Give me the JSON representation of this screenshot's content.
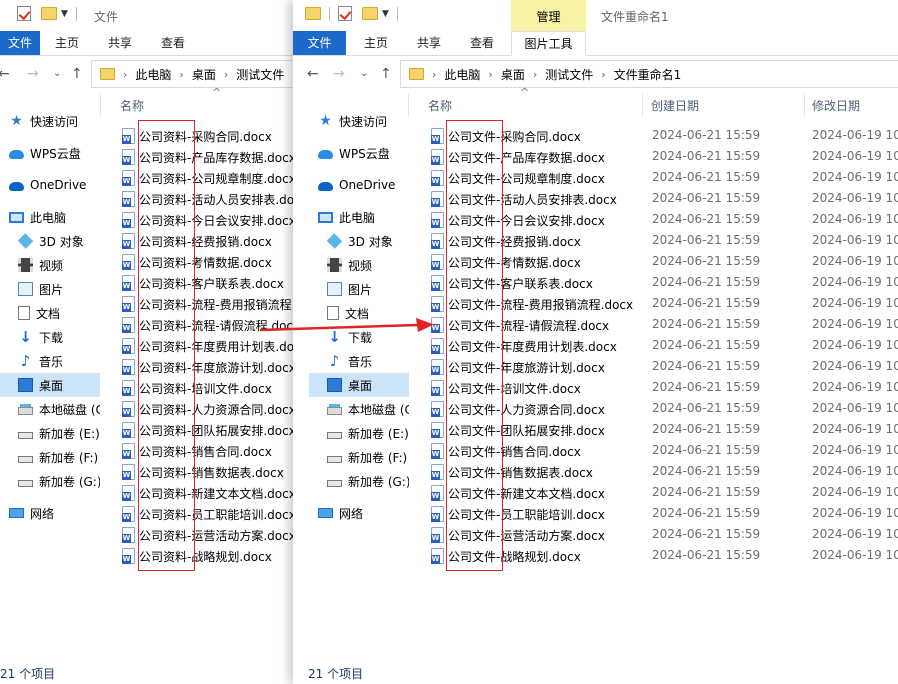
{
  "left_window": {
    "title": "文件",
    "ribbon": {
      "file": "文件",
      "home": "主页",
      "share": "共享",
      "view": "查看"
    },
    "address": [
      "此电脑",
      "桌面",
      "测试文件"
    ],
    "column_name": "名称",
    "status": "21 个项目"
  },
  "right_window": {
    "title": "文件重命名1",
    "ribbon": {
      "file": "文件",
      "home": "主页",
      "share": "共享",
      "view": "查看",
      "manage": "管理",
      "picture_tools": "图片工具"
    },
    "address": [
      "此电脑",
      "桌面",
      "测试文件",
      "文件重命名1"
    ],
    "columns": {
      "name": "名称",
      "created": "创建日期",
      "modified": "修改日期"
    },
    "status": "21 个项目"
  },
  "nav_items": [
    {
      "label": "快速访问",
      "icon": "star-icon"
    },
    {
      "label": "WPS云盘",
      "icon": "cloud-icon"
    },
    {
      "label": "OneDrive",
      "icon": "onedrive-icon"
    },
    {
      "label": "此电脑",
      "icon": "computer-icon"
    },
    {
      "label": "3D 对象",
      "icon": "cube-icon"
    },
    {
      "label": "视频",
      "icon": "video-icon"
    },
    {
      "label": "图片",
      "icon": "picture-icon"
    },
    {
      "label": "文档",
      "icon": "document-icon"
    },
    {
      "label": "下载",
      "icon": "download-icon"
    },
    {
      "label": "音乐",
      "icon": "music-icon"
    },
    {
      "label": "桌面",
      "icon": "desktop-icon"
    },
    {
      "label": "本地磁盘 (C:)",
      "icon": "local-disk-icon"
    },
    {
      "label": "新加卷 (E:)",
      "icon": "drive-icon"
    },
    {
      "label": "新加卷 (F:)",
      "icon": "drive-icon"
    },
    {
      "label": "新加卷 (G:)",
      "icon": "drive-icon"
    },
    {
      "label": "网络",
      "icon": "network-icon"
    }
  ],
  "left_files": [
    "公司资料-采购合同.docx",
    "公司资料-产品库存数据.docx",
    "公司资料-公司规章制度.docx",
    "公司资料-活动人员安排表.docx",
    "公司资料-今日会议安排.docx",
    "公司资料-经费报销.docx",
    "公司资料-考情数据.docx",
    "公司资料-客户联系表.docx",
    "公司资料-流程-费用报销流程.docx",
    "公司资料-流程-请假流程.docx",
    "公司资料-年度费用计划表.docx",
    "公司资料-年度旅游计划.docx",
    "公司资料-培训文件.docx",
    "公司资料-人力资源合同.docx",
    "公司资料-团队拓展安排.docx",
    "公司资料-销售合同.docx",
    "公司资料-销售数据表.docx",
    "公司资料-新建文本文档.docx",
    "公司资料-员工职能培训.docx",
    "公司资料-运营活动方案.docx",
    "公司资料-战略规划.docx"
  ],
  "right_files": [
    {
      "name": "公司文件-采购合同.docx",
      "created": "2024-06-21 15:59",
      "modified": "2024-06-19 10:"
    },
    {
      "name": "公司文件-产品库存数据.docx",
      "created": "2024-06-21 15:59",
      "modified": "2024-06-19 10:"
    },
    {
      "name": "公司文件-公司规章制度.docx",
      "created": "2024-06-21 15:59",
      "modified": "2024-06-19 10:"
    },
    {
      "name": "公司文件-活动人员安排表.docx",
      "created": "2024-06-21 15:59",
      "modified": "2024-06-19 10:"
    },
    {
      "name": "公司文件-今日会议安排.docx",
      "created": "2024-06-21 15:59",
      "modified": "2024-06-19 10:"
    },
    {
      "name": "公司文件-经费报销.docx",
      "created": "2024-06-21 15:59",
      "modified": "2024-06-19 10:"
    },
    {
      "name": "公司文件-考情数据.docx",
      "created": "2024-06-21 15:59",
      "modified": "2024-06-19 10:"
    },
    {
      "name": "公司文件-客户联系表.docx",
      "created": "2024-06-21 15:59",
      "modified": "2024-06-19 10:"
    },
    {
      "name": "公司文件-流程-费用报销流程.docx",
      "created": "2024-06-21 15:59",
      "modified": "2024-06-19 10:"
    },
    {
      "name": "公司文件-流程-请假流程.docx",
      "created": "2024-06-21 15:59",
      "modified": "2024-06-19 10:"
    },
    {
      "name": "公司文件-年度费用计划表.docx",
      "created": "2024-06-21 15:59",
      "modified": "2024-06-19 10:"
    },
    {
      "name": "公司文件-年度旅游计划.docx",
      "created": "2024-06-21 15:59",
      "modified": "2024-06-19 10:"
    },
    {
      "name": "公司文件-培训文件.docx",
      "created": "2024-06-21 15:59",
      "modified": "2024-06-19 10:"
    },
    {
      "name": "公司文件-人力资源合同.docx",
      "created": "2024-06-21 15:59",
      "modified": "2024-06-19 10:"
    },
    {
      "name": "公司文件-团队拓展安排.docx",
      "created": "2024-06-21 15:59",
      "modified": "2024-06-19 10:"
    },
    {
      "name": "公司文件-销售合同.docx",
      "created": "2024-06-21 15:59",
      "modified": "2024-06-19 10:"
    },
    {
      "name": "公司文件-销售数据表.docx",
      "created": "2024-06-21 15:59",
      "modified": "2024-06-19 10:"
    },
    {
      "name": "公司文件-新建文本文档.docx",
      "created": "2024-06-21 15:59",
      "modified": "2024-06-19 10:"
    },
    {
      "name": "公司文件-员工职能培训.docx",
      "created": "2024-06-21 15:59",
      "modified": "2024-06-19 10:"
    },
    {
      "name": "公司文件-运营活动方案.docx",
      "created": "2024-06-21 15:59",
      "modified": "2024-06-19 10:"
    },
    {
      "name": "公司文件-战略规划.docx",
      "created": "2024-06-21 15:59",
      "modified": "2024-06-19 10:"
    }
  ],
  "colors": {
    "accent": "#1b6ac9",
    "selection": "#cce4f7",
    "highlight_box": "#e02525",
    "manage_tab": "#f8f3a4"
  }
}
